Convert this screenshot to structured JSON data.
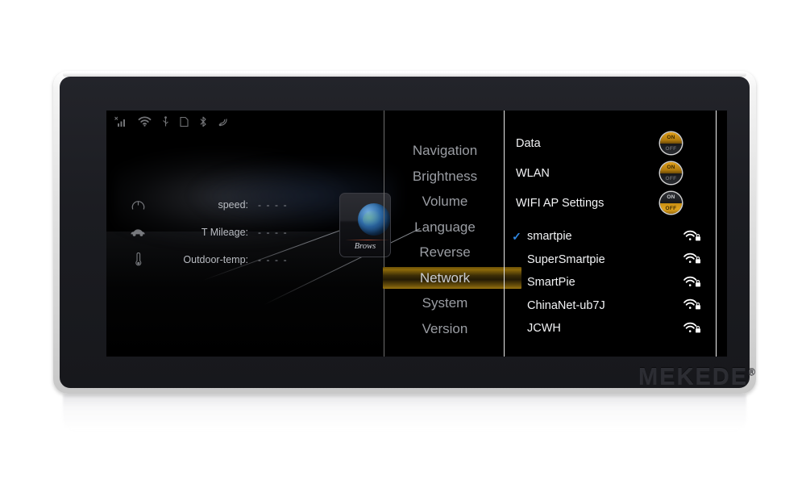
{
  "device": {
    "brand_logo": "MEKEDE",
    "brand_trademark": "®"
  },
  "screen": {
    "statusbar": {
      "icons": [
        {
          "name": "signal-bars-no-service-icon",
          "glyph": "signal"
        },
        {
          "name": "wifi-icon",
          "glyph": "wifi"
        },
        {
          "name": "usb-icon",
          "glyph": "usb"
        },
        {
          "name": "sim-card-icon",
          "glyph": "sim"
        },
        {
          "name": "bluetooth-icon",
          "glyph": "bluetooth"
        },
        {
          "name": "sound-waves-icon",
          "glyph": "waves"
        }
      ]
    },
    "vehicle_info": {
      "rows": [
        {
          "icon": "speedometer-icon",
          "label": "speed:",
          "value": "- - - -"
        },
        {
          "icon": "car-icon",
          "label": "T Mileage:",
          "value": "- - - -"
        },
        {
          "icon": "thermometer-icon",
          "label": "Outdoor-temp:",
          "value": "- - - -"
        }
      ]
    },
    "browser_widget": {
      "icon": "globe-icon",
      "label": "Brows"
    },
    "settings_menu": {
      "items": [
        {
          "label": "Navigation",
          "active": false
        },
        {
          "label": "Brightness",
          "active": false
        },
        {
          "label": "Volume",
          "active": false
        },
        {
          "label": "Language",
          "active": false
        },
        {
          "label": "Reverse",
          "active": false
        },
        {
          "label": "Network",
          "active": true
        },
        {
          "label": "System",
          "active": false
        },
        {
          "label": "Version",
          "active": false
        }
      ],
      "active_highlight_color": "#8d6a0a"
    },
    "network_panel": {
      "toggles": [
        {
          "label": "Data",
          "state": "on",
          "on_text": "ON",
          "off_text": "OFF"
        },
        {
          "label": "WLAN",
          "state": "on",
          "on_text": "ON",
          "off_text": "OFF"
        },
        {
          "label": "WIFI AP Settings",
          "state": "off",
          "on_text": "ON",
          "off_text": "OFF"
        }
      ],
      "wifi_networks": [
        {
          "ssid": "smartpie",
          "connected": true,
          "secured": true,
          "check_glyph": "✓"
        },
        {
          "ssid": "SuperSmartpie",
          "connected": false,
          "secured": true,
          "check_glyph": ""
        },
        {
          "ssid": "SmartPie",
          "connected": false,
          "secured": true,
          "check_glyph": ""
        },
        {
          "ssid": "ChinaNet-ub7J",
          "connected": false,
          "secured": true,
          "check_glyph": ""
        },
        {
          "ssid": "JCWH",
          "connected": false,
          "secured": true,
          "check_glyph": ""
        }
      ],
      "connected_check_color": "#2f86e0"
    }
  }
}
